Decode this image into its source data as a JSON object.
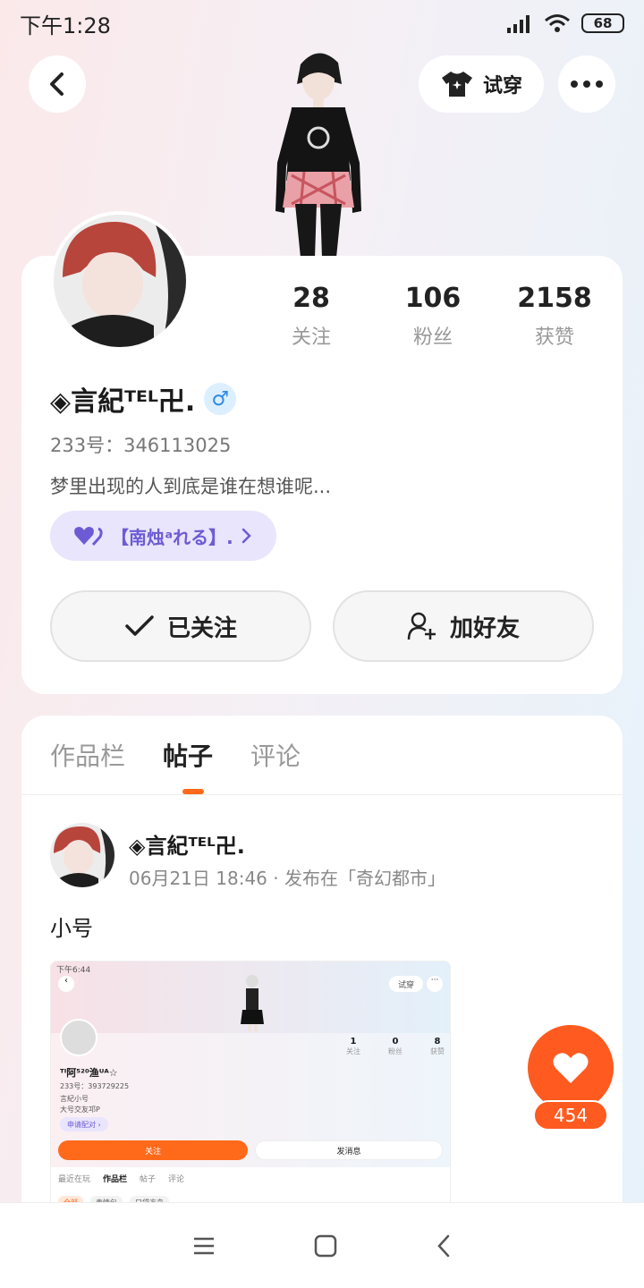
{
  "status_bar": {
    "time": "下午1:28",
    "battery": "68"
  },
  "header": {
    "try_on_label": "试穿"
  },
  "profile": {
    "stats": [
      {
        "value": "28",
        "label": "关注"
      },
      {
        "value": "106",
        "label": "粉丝"
      },
      {
        "value": "2158",
        "label": "获赞"
      }
    ],
    "name": "◈言紀ᵀᴱᴸ卍.",
    "gender_symbol": "♂",
    "uid": "233号：346113025",
    "bio": "梦里出现的人到底是谁在想谁呢...",
    "pair_label": "【南烛ᵃれる】.",
    "follow_label": "已关注",
    "add_friend_label": "加好友"
  },
  "tabs": [
    {
      "label": "作品栏",
      "active": false
    },
    {
      "label": "帖子",
      "active": true
    },
    {
      "label": "评论",
      "active": false
    }
  ],
  "post": {
    "author": "◈言紀ᵀᴱᴸ卍.",
    "meta": "06月21日 18:46 · 发布在「奇幻都市」",
    "text": "小号",
    "screenshot": {
      "time": "下午6:44",
      "try_on": "试穿",
      "stats": [
        {
          "value": "1",
          "label": "关注"
        },
        {
          "value": "0",
          "label": "粉丝"
        },
        {
          "value": "8",
          "label": "获赞"
        }
      ],
      "name": "ᵀᴵ阿⁵²⁰渔ᵁᴬ☆",
      "uid": "233号：393729225",
      "bio1": "言紀小号",
      "bio2": "大号交友邛P",
      "pair": "申请配对 ›",
      "follow": "关注",
      "message": "发消息",
      "tabs": [
        "最近在玩",
        "作品栏",
        "帖子",
        "评论"
      ],
      "chips": [
        "全部",
        "表情包",
        "口袋方舟"
      ]
    }
  },
  "like": {
    "count": "454"
  },
  "colors": {
    "accent": "#ff5a1f",
    "pair_text": "#6d5bd5",
    "pair_bg": "#e9e5fc"
  }
}
